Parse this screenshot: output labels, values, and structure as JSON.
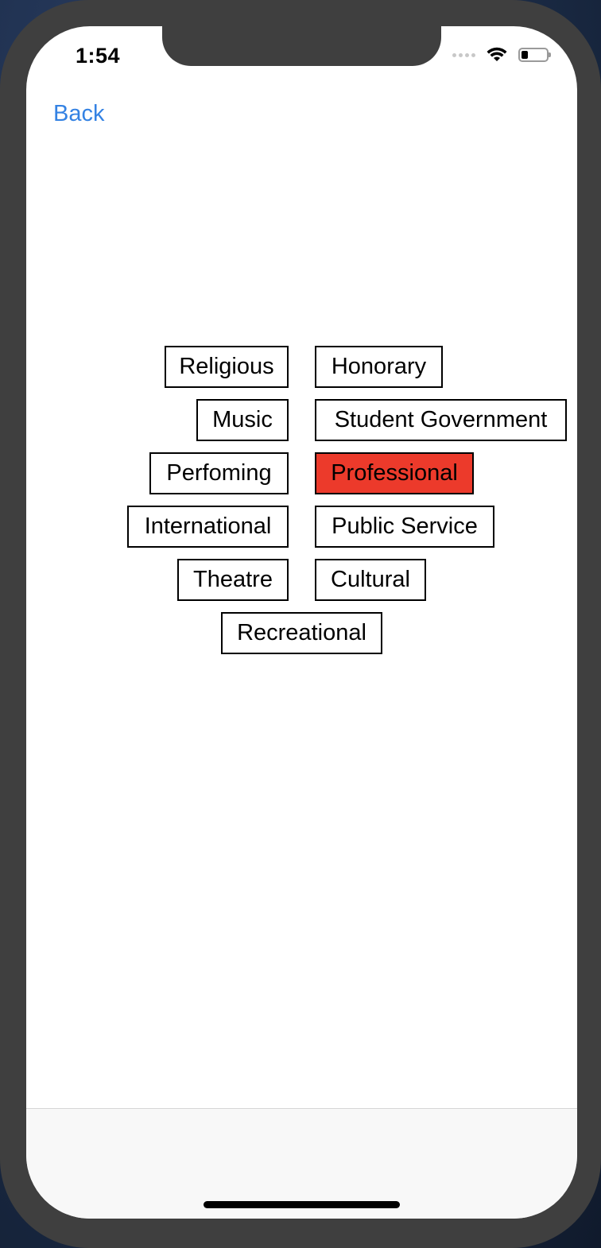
{
  "status_bar": {
    "time": "1:54"
  },
  "nav": {
    "back_label": "Back"
  },
  "colors": {
    "link": "#3482e3",
    "selected_tag": "#ec3a2b"
  },
  "tags": {
    "religious": "Religious",
    "honorary": "Honorary",
    "music": "Music",
    "student_government": "Student Government",
    "perfoming": "Perfoming",
    "professional": "Professional",
    "international": "International",
    "public_service": "Public Service",
    "theatre": "Theatre",
    "cultural": "Cultural",
    "recreational": "Recreational"
  },
  "selected_tag": "Professional"
}
